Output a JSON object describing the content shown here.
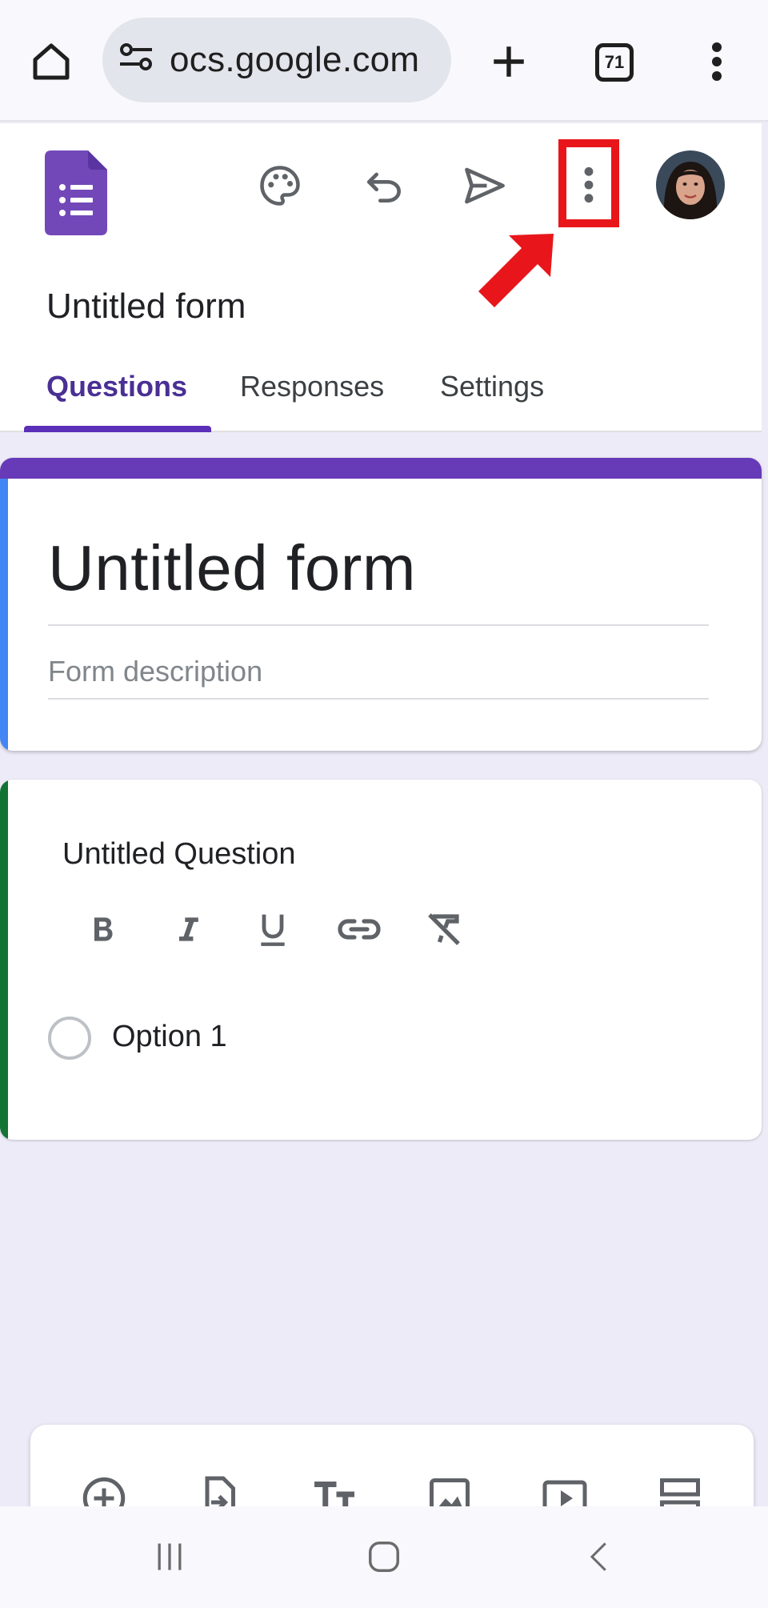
{
  "browser": {
    "url": "ocs.google.com",
    "tab_count": "71",
    "icons": [
      "home-icon",
      "site-settings-icon",
      "new-tab-icon",
      "tab-switcher-icon",
      "more-vert-icon"
    ]
  },
  "forms_header": {
    "form_name": "Untitled form",
    "tabs": [
      {
        "label": "Questions",
        "active": true
      },
      {
        "label": "Responses",
        "active": false
      },
      {
        "label": "Settings",
        "active": false
      }
    ],
    "icons": [
      "forms-logo-icon",
      "palette-icon",
      "undo-icon",
      "send-icon",
      "more-vert-icon",
      "avatar"
    ],
    "annotation": "red box and arrow highlighting more options menu",
    "accent_color": "#673ab7"
  },
  "title_card": {
    "title": "Untitled form",
    "description_placeholder": "Form description"
  },
  "question_card": {
    "title": "Untitled Question",
    "format_tools": [
      "bold-icon",
      "italic-icon",
      "underline-icon",
      "link-icon",
      "clear-format-icon"
    ],
    "options": [
      "Option 1"
    ]
  },
  "toolbar": {
    "tools": [
      "add-question-icon",
      "import-questions-icon",
      "add-title-icon",
      "add-image-icon",
      "add-video-icon",
      "add-section-icon"
    ]
  },
  "nav_bar": {
    "buttons": [
      "recents-icon",
      "home-icon",
      "back-icon"
    ]
  }
}
